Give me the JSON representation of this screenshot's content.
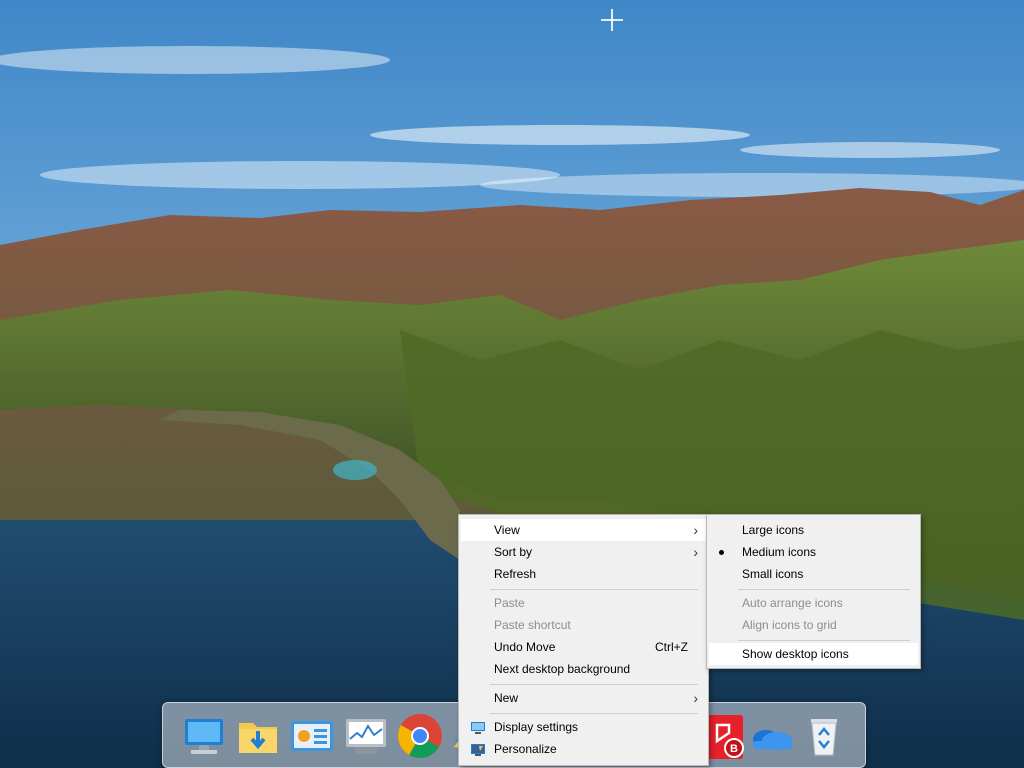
{
  "context_menu": {
    "items": [
      {
        "label": "View",
        "has_submenu": true
      },
      {
        "label": "Sort by",
        "has_submenu": true
      },
      {
        "label": "Refresh"
      },
      {
        "label": "Paste",
        "disabled": true
      },
      {
        "label": "Paste shortcut",
        "disabled": true
      },
      {
        "label": "Undo Move",
        "shortcut": "Ctrl+Z"
      },
      {
        "label": "Next desktop background"
      },
      {
        "label": "New",
        "has_submenu": true
      },
      {
        "label": "Display settings",
        "icon": "display-settings-icon"
      },
      {
        "label": "Personalize",
        "icon": "personalize-icon"
      }
    ]
  },
  "view_submenu": {
    "items": [
      {
        "label": "Large icons"
      },
      {
        "label": "Medium icons",
        "selected": true
      },
      {
        "label": "Small icons"
      },
      {
        "label": "Auto arrange icons",
        "disabled": true
      },
      {
        "label": "Align icons to grid",
        "disabled": true
      },
      {
        "label": "Show desktop icons",
        "highlighted": true
      }
    ]
  },
  "dock": {
    "icons": [
      "this-pc-icon",
      "downloads-folder-icon",
      "control-panel-icon",
      "performance-monitor-icon",
      "chrome-icon",
      "app-icon",
      "bitdefender-icon",
      "onedrive-icon",
      "recycle-bin-icon"
    ]
  },
  "colors": {
    "menu_bg": "#f0f0f0",
    "menu_border": "#b8b8b8",
    "disabled_text": "#8d8d8d"
  }
}
